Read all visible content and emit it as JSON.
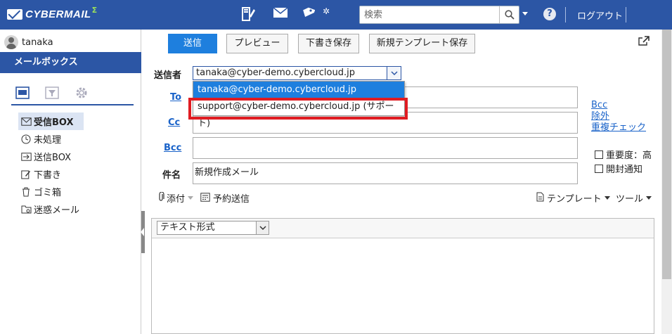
{
  "app": {
    "logo_text": "CYBERMAIL",
    "logo_sigma": "Σ"
  },
  "header": {
    "search_placeholder": "検索",
    "logout_label": "ログアウト",
    "help_label": "?",
    "icons": [
      "address-book-icon",
      "mail-icon",
      "tag-icon",
      "settings-icon",
      "search-icon",
      "chevron-down-icon",
      "help-icon"
    ]
  },
  "sidebar": {
    "username": "tanaka",
    "mailbox_title": "メールボックス",
    "tabs": [
      "mailbox-icon",
      "filter-icon",
      "gear-icon"
    ],
    "folders": [
      {
        "label": "受信BOX",
        "icon": "inbox-icon",
        "active": true
      },
      {
        "label": "未処理",
        "icon": "clock-icon",
        "active": false
      },
      {
        "label": "送信BOX",
        "icon": "outbox-icon",
        "active": false
      },
      {
        "label": "下書き",
        "icon": "draft-icon",
        "active": false
      },
      {
        "label": "ゴミ箱",
        "icon": "trash-icon",
        "active": false
      },
      {
        "label": "迷惑メール",
        "icon": "spam-icon",
        "active": false
      }
    ]
  },
  "compose": {
    "buttons": {
      "send": "送信",
      "preview": "プレビュー",
      "save_draft": "下書き保存",
      "save_template": "新規テンプレート保存"
    },
    "sender_label": "送信者",
    "sender_value": "tanaka@cyber-demo.cybercloud.jp",
    "sender_options": [
      "tanaka@cyber-demo.cybercloud.jp",
      "support@cyber-demo.cybercloud.jp (サポート)"
    ],
    "to_label": "To",
    "cc_label": "Cc",
    "bcc_label": "Bcc",
    "subject_label": "件名",
    "subject_value": "新規作成メール",
    "side_links": {
      "bcc": "Bcc",
      "exclude": "除外",
      "duplicate_check": "重複チェック"
    },
    "options": {
      "importance": "重要度：高",
      "read_receipt": "開封通知"
    },
    "toolbar": {
      "attach": "添付",
      "scheduled_send": "予約送信",
      "template": "テンプレート",
      "tools": "ツール"
    },
    "editor_format": "テキスト形式"
  },
  "colors": {
    "header_bg": "#2c56a5",
    "primary_button": "#1e7fde",
    "highlight": "#e01c22",
    "link": "#1a63c9"
  }
}
